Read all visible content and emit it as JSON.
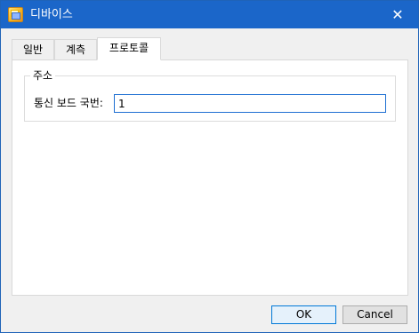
{
  "window": {
    "title": "디바이스",
    "close_glyph": "✕",
    "app_icon": "device-settings-icon"
  },
  "tabs": [
    {
      "label": "일반",
      "selected": false
    },
    {
      "label": "계측",
      "selected": false
    },
    {
      "label": "프로토콜",
      "selected": true
    }
  ],
  "address_group": {
    "legend": "주소",
    "board_number_label": "통신 보드 국번:",
    "board_number_value": "1"
  },
  "buttons": {
    "ok": "OK",
    "cancel": "Cancel"
  },
  "colors": {
    "titlebar": "#1b66c9",
    "focus_border": "#0078d7",
    "dialog_background": "#f0f0f0"
  }
}
